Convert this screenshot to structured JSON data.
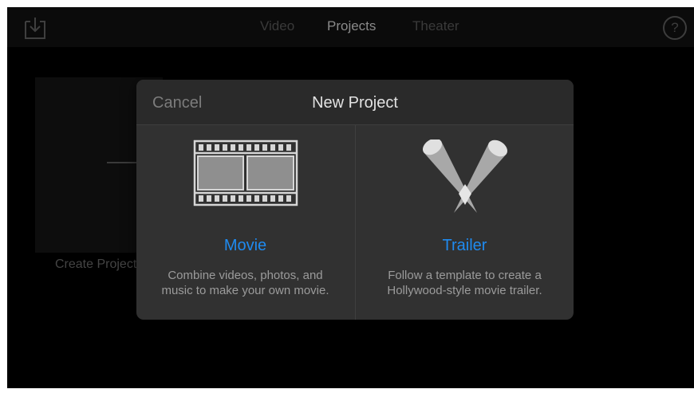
{
  "topbar": {
    "import_icon": "import-download-icon",
    "tabs": [
      {
        "label": "Video",
        "active": false
      },
      {
        "label": "Projects",
        "active": true
      },
      {
        "label": "Theater",
        "active": false
      }
    ],
    "help_label": "?"
  },
  "background": {
    "create_label": "Create Project"
  },
  "modal": {
    "title": "New Project",
    "cancel_label": "Cancel",
    "options": [
      {
        "label": "Movie",
        "icon": "film-strip-icon",
        "description_lines": [
          "Combine videos, photos, and",
          "music to make your own movie."
        ]
      },
      {
        "label": "Trailer",
        "icon": "spotlights-icon",
        "description_lines": [
          "Follow a template to create a",
          "Hollywood-style movie trailer."
        ]
      }
    ]
  },
  "colors": {
    "accent": "#1f8bf0",
    "modal_bg": "#313131",
    "app_bg": "#000000"
  }
}
